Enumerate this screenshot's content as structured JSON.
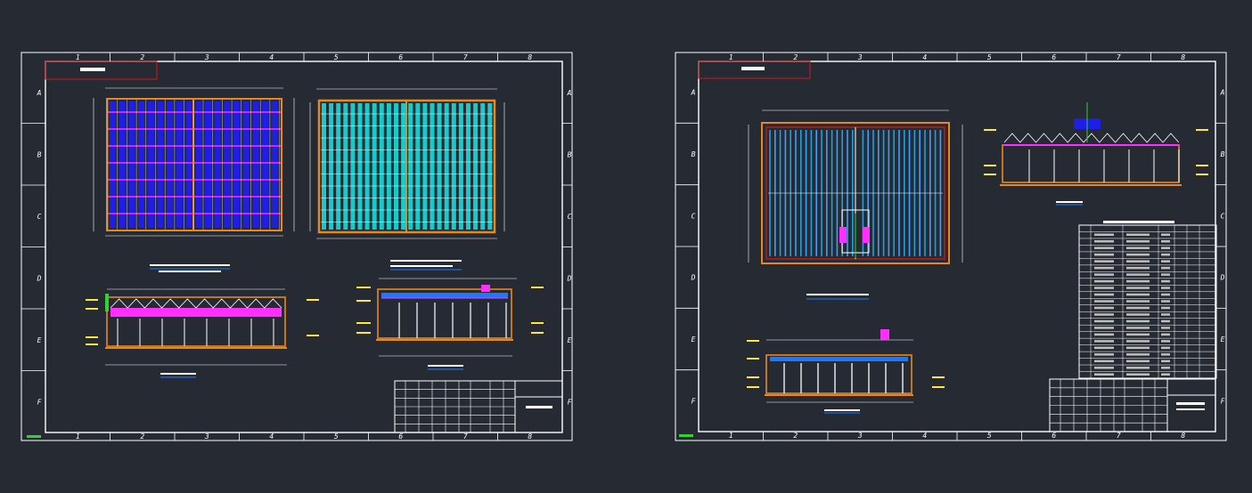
{
  "colors": {
    "background": "#262b33",
    "frame": "#ffffff",
    "title_box": "#d01818",
    "wall": "#e8871e",
    "pipe": "#ff30ff",
    "panel_blue": "#1e1ee6",
    "panel_cyan": "#19c8c8",
    "dim_green": "#32d232",
    "lightblue": "#3aa0ff",
    "mid_blue": "#1e78ff",
    "marker_yellow": "#ffe640"
  },
  "sheet_left": {
    "columns": [
      "1",
      "2",
      "3",
      "4",
      "5",
      "6",
      "7",
      "8"
    ],
    "rows": [
      "A",
      "B",
      "C",
      "D",
      "E",
      "F"
    ]
  },
  "sheet_right": {
    "columns": [
      "1",
      "2",
      "3",
      "4",
      "5",
      "6",
      "7",
      "8"
    ],
    "rows": [
      "A",
      "B",
      "C",
      "D",
      "E",
      "F"
    ]
  }
}
